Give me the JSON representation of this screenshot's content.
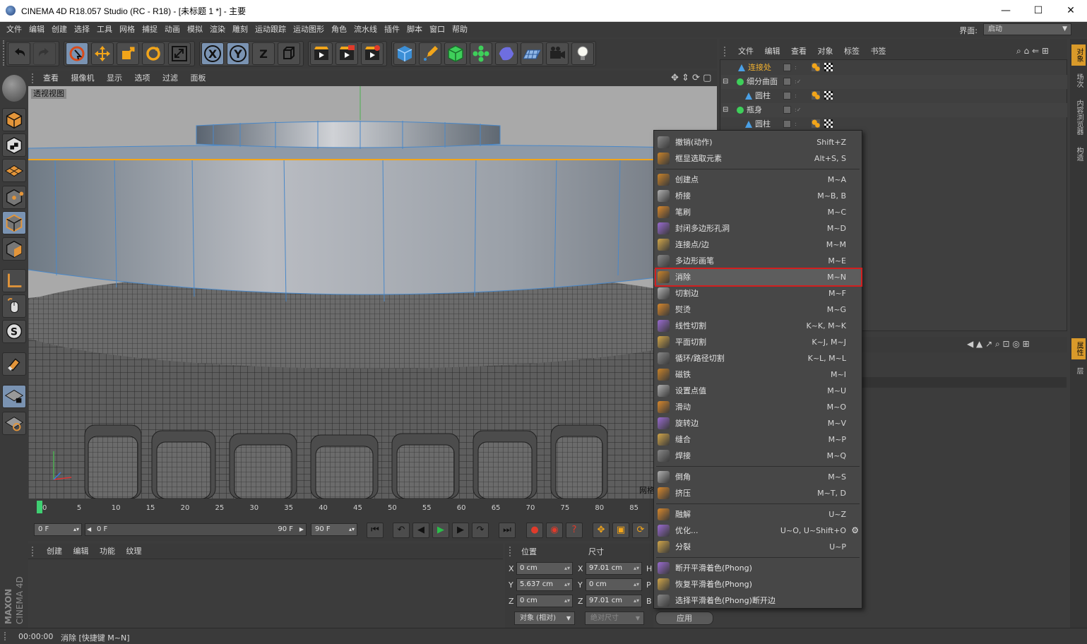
{
  "window": {
    "title": "CINEMA 4D R18.057 Studio (RC - R18) - [未标题 1 *] - 主要",
    "controls": [
      "—",
      "☐",
      "✕"
    ]
  },
  "menubar": [
    "文件",
    "编辑",
    "创建",
    "选择",
    "工具",
    "网格",
    "捕捉",
    "动画",
    "模拟",
    "渲染",
    "雕刻",
    "运动跟踪",
    "运动图形",
    "角色",
    "流水线",
    "插件",
    "脚本",
    "窗口",
    "帮助"
  ],
  "layout": {
    "label": "界面:",
    "value": "启动"
  },
  "viewport": {
    "menu": [
      "查看",
      "摄像机",
      "显示",
      "选项",
      "过滤",
      "面板"
    ],
    "label": "透视视图",
    "corner_text": "网格"
  },
  "timeline": {
    "ticks": [
      "0",
      "5",
      "10",
      "15",
      "20",
      "25",
      "30",
      "35",
      "40",
      "45",
      "50",
      "55",
      "60",
      "65",
      "70",
      "75",
      "80",
      "85"
    ]
  },
  "transport": {
    "current_frame": "0 F",
    "range_start": "0 F",
    "range_end": "90 F",
    "max_frame": "90 F"
  },
  "material_manager": {
    "menu": [
      "创建",
      "编辑",
      "功能",
      "纹理"
    ]
  },
  "coordinates": {
    "headers": [
      "位置",
      "尺寸"
    ],
    "rows": [
      {
        "axis": "X",
        "pos": "0 cm",
        "size_axis": "X",
        "size": "97.01 cm",
        "rot": "H"
      },
      {
        "axis": "Y",
        "pos": "5.637 cm",
        "size_axis": "Y",
        "size": "0 cm",
        "rot": "P"
      },
      {
        "axis": "Z",
        "pos": "0 cm",
        "size_axis": "Z",
        "size": "97.01 cm",
        "rot": "B"
      }
    ],
    "mode": "对象 (相对)",
    "size_mode": "绝对尺寸",
    "apply": "应用"
  },
  "object_manager": {
    "menu": [
      "文件",
      "编辑",
      "查看",
      "对象",
      "标签",
      "书签"
    ],
    "objects": [
      {
        "name": "连接处",
        "selected": true
      },
      {
        "name": "细分曲面",
        "selected": false
      },
      {
        "name": "圆柱",
        "selected": false
      },
      {
        "name": "瓶身",
        "selected": false
      },
      {
        "name": "圆柱",
        "selected": false
      }
    ]
  },
  "right_tabs": [
    "对象",
    "场次",
    "内容浏览器",
    "构造",
    "属性",
    "层"
  ],
  "context_menu": {
    "groups": [
      [
        {
          "label": "撤销(动作)",
          "shortcut": "Shift+Z"
        },
        {
          "label": "框显选取元素",
          "shortcut": "Alt+S, S"
        }
      ],
      [
        {
          "label": "创建点",
          "shortcut": "M~A"
        },
        {
          "label": "桥接",
          "shortcut": "M~B, B"
        },
        {
          "label": "笔刷",
          "shortcut": "M~C"
        },
        {
          "label": "封闭多边形孔洞",
          "shortcut": "M~D"
        },
        {
          "label": "连接点/边",
          "shortcut": "M~M"
        },
        {
          "label": "多边形画笔",
          "shortcut": "M~E"
        },
        {
          "label": "消除",
          "shortcut": "M~N"
        },
        {
          "label": "切割边",
          "shortcut": "M~F"
        },
        {
          "label": "熨烫",
          "shortcut": "M~G"
        },
        {
          "label": "线性切割",
          "shortcut": "K~K, M~K"
        },
        {
          "label": "平面切割",
          "shortcut": "K~J, M~J"
        },
        {
          "label": "循环/路径切割",
          "shortcut": "K~L, M~L"
        },
        {
          "label": "磁铁",
          "shortcut": "M~I"
        },
        {
          "label": "设置点值",
          "shortcut": "M~U"
        },
        {
          "label": "滑动",
          "shortcut": "M~O"
        },
        {
          "label": "旋转边",
          "shortcut": "M~V"
        },
        {
          "label": "缝合",
          "shortcut": "M~P"
        },
        {
          "label": "焊接",
          "shortcut": "M~Q"
        }
      ],
      [
        {
          "label": "倒角",
          "shortcut": "M~S"
        },
        {
          "label": "挤压",
          "shortcut": "M~T, D"
        }
      ],
      [
        {
          "label": "融解",
          "shortcut": "U~Z"
        },
        {
          "label": "优化...",
          "shortcut": "U~O, U~Shift+O"
        },
        {
          "label": "分裂",
          "shortcut": "U~P"
        }
      ],
      [
        {
          "label": "断开平滑着色(Phong)",
          "shortcut": ""
        },
        {
          "label": "恢复平滑着色(Phong)",
          "shortcut": ""
        },
        {
          "label": "选择平滑着色(Phong)断开边",
          "shortcut": ""
        }
      ]
    ]
  },
  "status": {
    "time": "00:00:00",
    "message": "消除 [快捷键 M~N]"
  },
  "logo": {
    "text": "MAXON CINEMA 4D"
  },
  "colors": {
    "accent": "#d99a2a",
    "highlight_box": "#d21f1f",
    "playhead": "#3fcf72",
    "selection_text": "#f0b030"
  }
}
